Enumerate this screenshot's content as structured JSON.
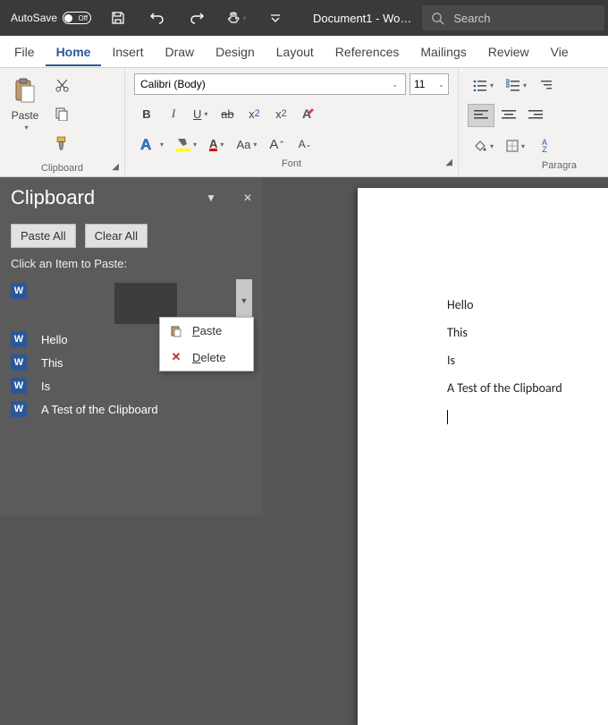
{
  "titlebar": {
    "autosave_label": "AutoSave",
    "autosave_state": "Off",
    "doc_title": "Document1  -  Wo…",
    "search_placeholder": "Search"
  },
  "tabs": {
    "items": [
      "File",
      "Home",
      "Insert",
      "Draw",
      "Design",
      "Layout",
      "References",
      "Mailings",
      "Review",
      "Vie"
    ],
    "active_index": 1
  },
  "ribbon": {
    "clipboard": {
      "paste_label": "Paste",
      "group_label": "Clipboard"
    },
    "font": {
      "font_name": "Calibri (Body)",
      "font_size": "11",
      "group_label": "Font",
      "bold": "B",
      "italic": "I",
      "underline": "U",
      "strike": "ab",
      "subscript": "x",
      "subscript_sub": "2",
      "superscript": "x",
      "superscript_sup": "2",
      "case_label": "Aa",
      "sort_label": "A\nZ"
    },
    "paragraph": {
      "group_label": "Paragra"
    }
  },
  "panel": {
    "title": "Clipboard",
    "paste_all": "Paste All",
    "clear_all": "Clear All",
    "hint": "Click an Item to Paste:",
    "items": [
      "",
      "Hello",
      "This",
      "Is",
      "A Test of the Clipboard"
    ]
  },
  "context_menu": {
    "paste": "Paste",
    "delete": "Delete"
  },
  "document": {
    "lines": [
      "Hello",
      "This",
      "Is",
      "A Test of the Clipboard"
    ]
  }
}
